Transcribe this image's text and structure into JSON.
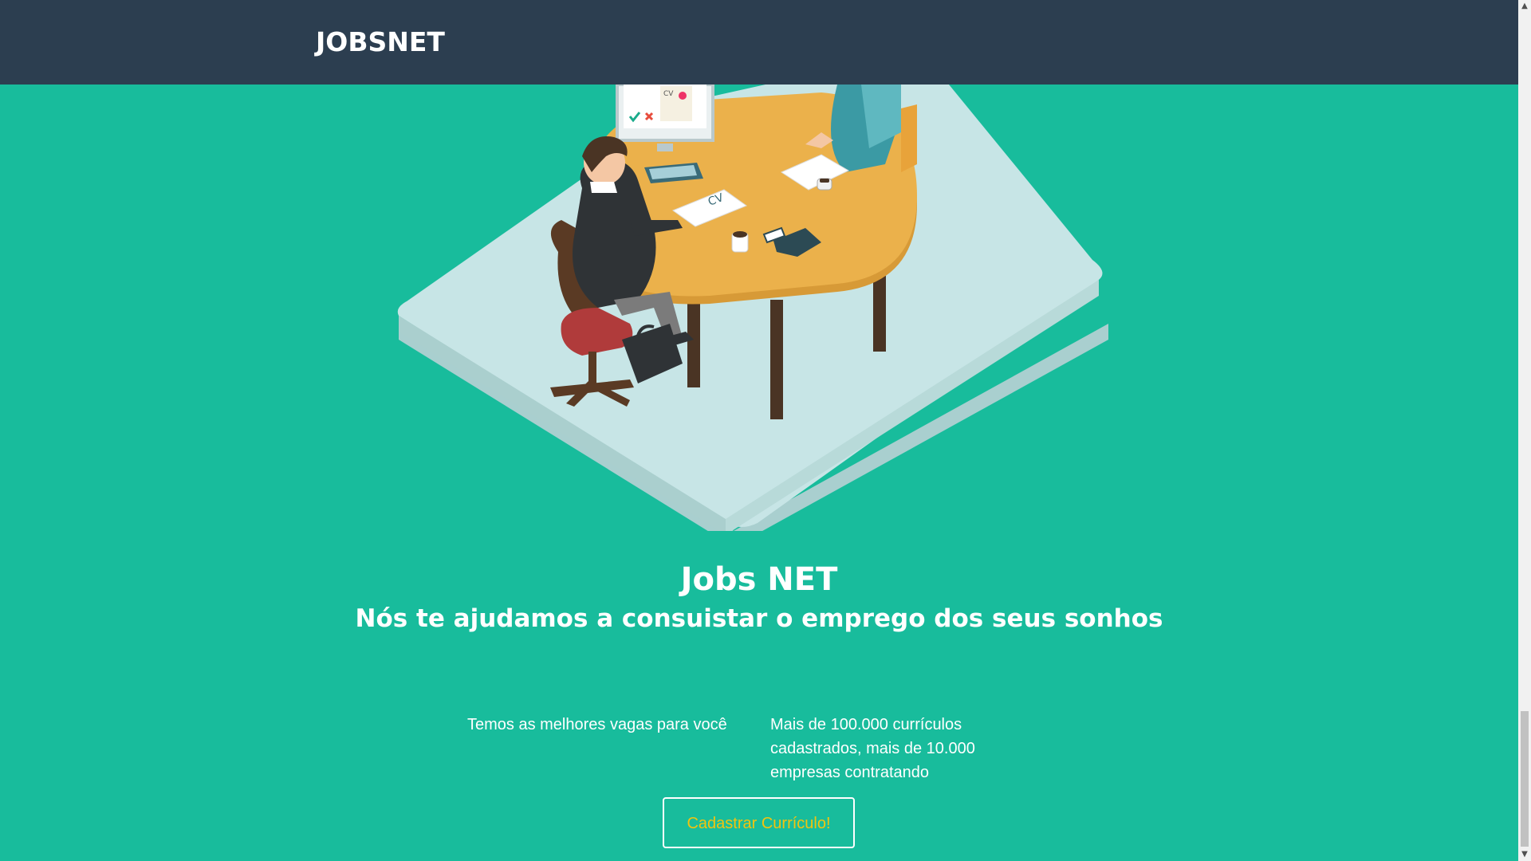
{
  "navbar": {
    "brand": "JOBSNET"
  },
  "hero": {
    "title": "Jobs NET",
    "subtitle": "Nós te ajudamos a consuistar o emprego dos seus sonhos"
  },
  "features": [
    {
      "text": "Temos as melhores  vagas para você"
    },
    {
      "text": "Mais de 100.000 currículos cadastrados, mais de 10.000 empresas contratando"
    }
  ],
  "cta": {
    "label": "Cadastrar Currículo!"
  },
  "illustration": {
    "cv_paper_label": "CV",
    "monitor_cv_label": "CV"
  },
  "colors": {
    "navbar": "#2c3e50",
    "hero_background": "#18bc9c",
    "cta_text": "#f1c40f",
    "text": "#ffffff"
  }
}
